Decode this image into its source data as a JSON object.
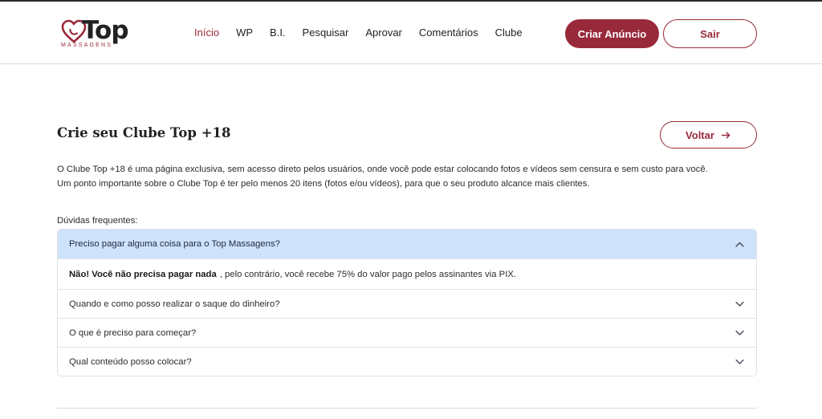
{
  "brand": {
    "name": "Top",
    "sub": "MASSAGENS",
    "accent_color": "#98293a"
  },
  "nav": {
    "items": [
      {
        "label": "Início",
        "active": true
      },
      {
        "label": "WP"
      },
      {
        "label": "B.I."
      },
      {
        "label": "Pesquisar"
      },
      {
        "label": "Aprovar"
      },
      {
        "label": "Comentários"
      },
      {
        "label": "Clube"
      }
    ]
  },
  "header_actions": {
    "create_label": "Criar Anúncio",
    "logout_label": "Sair"
  },
  "page": {
    "title": "Crie seu Clube Top +18",
    "back_label": "Voltar",
    "description": [
      "O Clube Top +18 é uma página exclusiva, sem acesso direto pelos usuários, onde você pode estar colocando fotos e vídeos sem censura e sem custo para você.",
      "Um ponto importante sobre o Clube Top é ter pelo menos 20 itens (fotos e/ou vídeos), para que o seu produto alcance mais clientes."
    ],
    "faq_label": "Dúvidas frequentes:"
  },
  "faq": [
    {
      "question": "Preciso pagar alguma coisa para o Top Massagens?",
      "open": true,
      "answer_bold": "Não! Você não precisa pagar nada",
      "answer_rest": ", pelo contrário, você recebe 75% do valor pago pelos assinantes via PIX."
    },
    {
      "question": "Quando e como posso realizar o saque do dinheiro?",
      "open": false
    },
    {
      "question": "O que é preciso para começar?",
      "open": false
    },
    {
      "question": "Qual conteúdo posso colocar?",
      "open": false
    }
  ],
  "icons": {
    "logo": "heart-logo-icon",
    "back": "arrow-right-icon",
    "open": "chevron-up-icon",
    "closed": "chevron-down-icon"
  }
}
